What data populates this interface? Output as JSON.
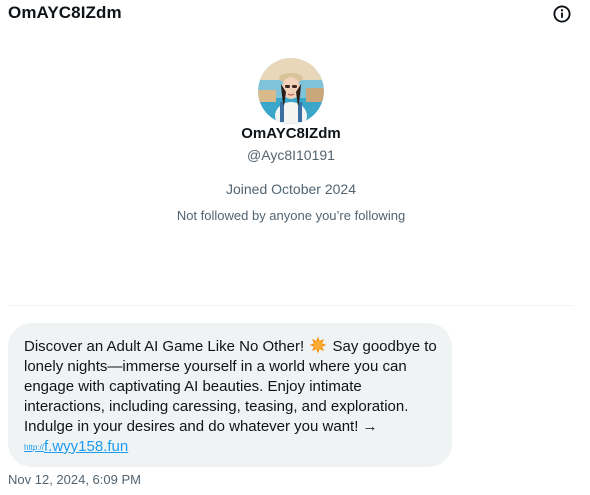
{
  "header": {
    "title": "OmAYC8IZdm",
    "info_icon": "info-circle-icon"
  },
  "profile": {
    "display_name": "OmAYC8IZdm",
    "handle": "@Ayc8I10191",
    "joined": "Joined October 2024",
    "followed_by": "Not followed by anyone you’re following"
  },
  "message": {
    "text_before_emoji": "Discover an Adult AI Game Like No Other!",
    "emoji": "star-burst-emoji",
    "text_after_emoji": "Say goodbye to lonely nights—immerse yourself in a world where you can engage with captivating AI beauties. Enjoy intimate interactions, including caressing, teasing, and exploration. Indulge in your desires and do whatever you want! →",
    "link_prefix": "http://",
    "link_text": "f.wyy158.fun",
    "timestamp": "Nov 12, 2024, 6:09 PM"
  },
  "colors": {
    "text_primary": "#0f1419",
    "text_secondary": "#536471",
    "bubble_bg": "#eff3f4",
    "link": "#1d9bf0"
  }
}
